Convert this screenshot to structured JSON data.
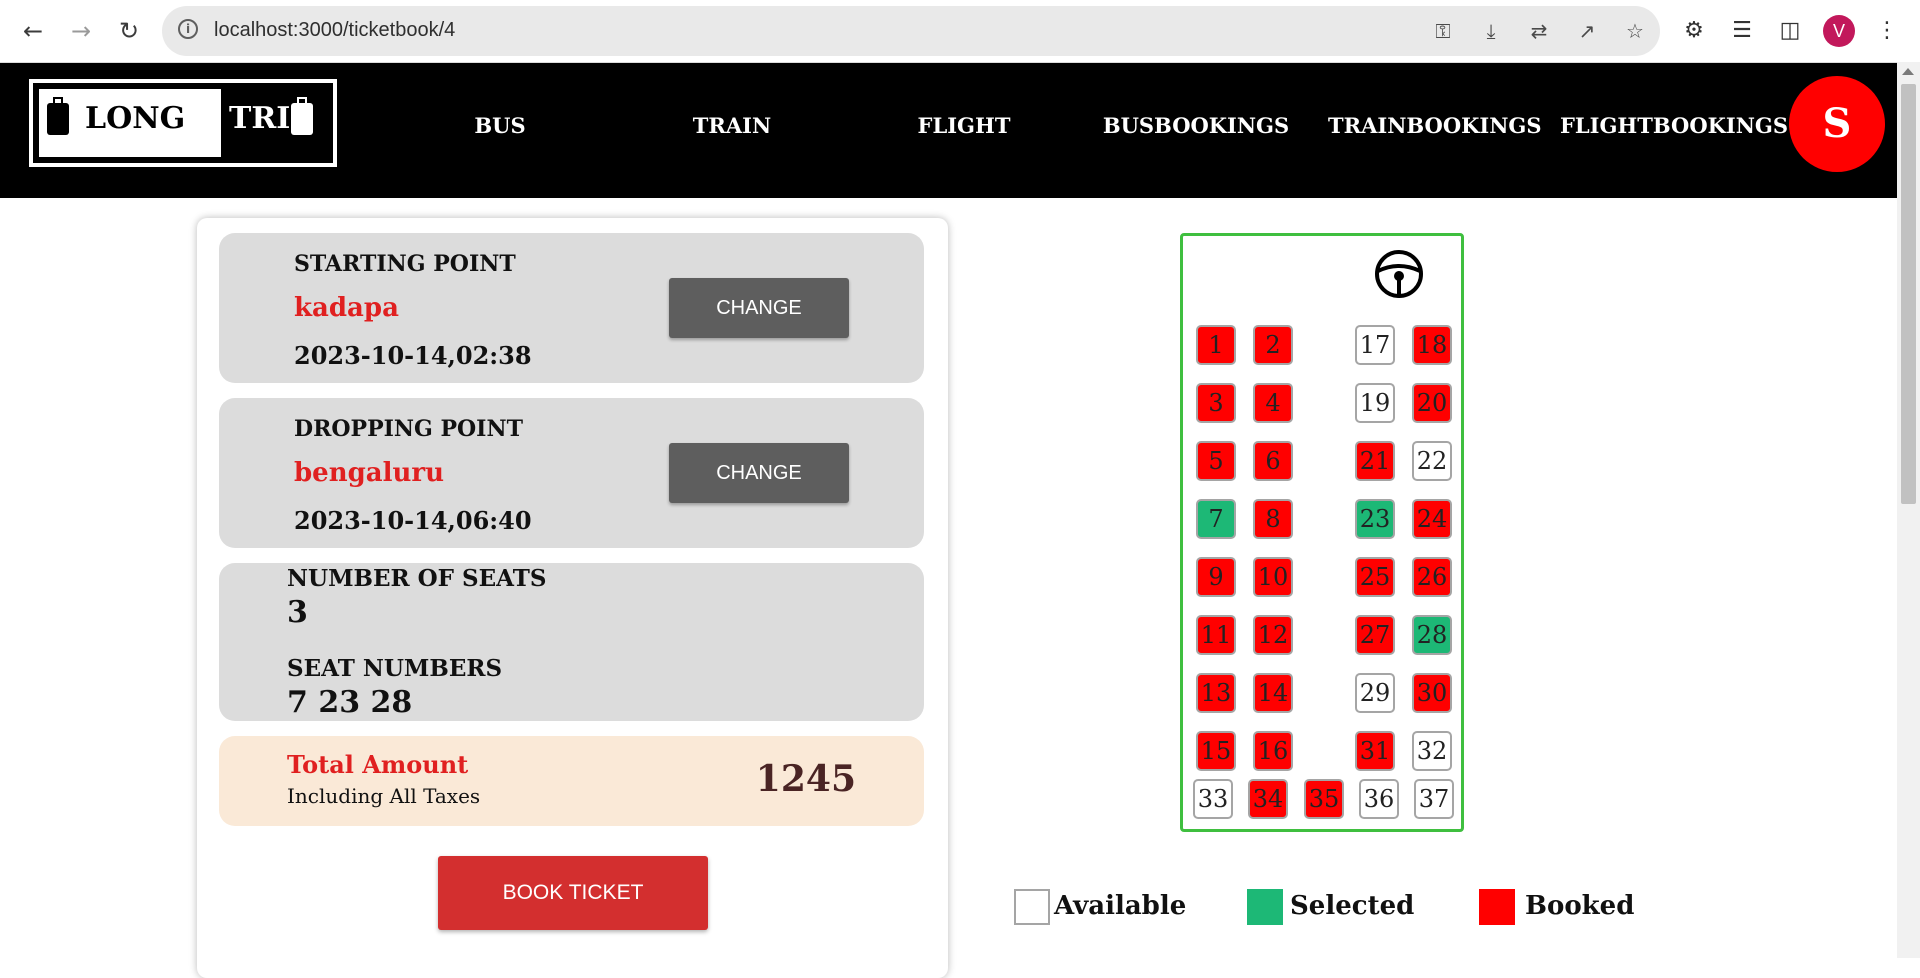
{
  "browser": {
    "url": "localhost:3000/ticketbook/4",
    "profile_initial": "V"
  },
  "navbar": {
    "logo_word1": "LONG",
    "logo_word2": "TRIP",
    "links": [
      "BUS",
      "TRAIN",
      "FLIGHT",
      "BUSBOOKINGS",
      "TRAINBOOKINGS",
      "FLIGHTBOOKINGS"
    ],
    "user_initial": "S"
  },
  "booking": {
    "starting": {
      "label": "STARTING POINT",
      "place": "kadapa",
      "datetime": "2023-10-14,02:38",
      "button": "CHANGE"
    },
    "dropping": {
      "label": "DROPPING POINT",
      "place": "bengaluru",
      "datetime": "2023-10-14,06:40",
      "button": "CHANGE"
    },
    "seats": {
      "count_label": "NUMBER OF SEATS",
      "count": "3",
      "numbers_label": "SEAT NUMBERS",
      "numbers": "7 23 28"
    },
    "total": {
      "label": "Total Amount",
      "sub": "Including All Taxes",
      "amount": "1245"
    },
    "book_button": "BOOK TICKET"
  },
  "seat_map": {
    "seats": [
      {
        "n": "1",
        "status": "booked"
      },
      {
        "n": "2",
        "status": "booked"
      },
      {
        "n": "3",
        "status": "booked"
      },
      {
        "n": "4",
        "status": "booked"
      },
      {
        "n": "5",
        "status": "booked"
      },
      {
        "n": "6",
        "status": "booked"
      },
      {
        "n": "7",
        "status": "selected"
      },
      {
        "n": "8",
        "status": "booked"
      },
      {
        "n": "9",
        "status": "booked"
      },
      {
        "n": "10",
        "status": "booked"
      },
      {
        "n": "11",
        "status": "booked"
      },
      {
        "n": "12",
        "status": "booked"
      },
      {
        "n": "13",
        "status": "booked"
      },
      {
        "n": "14",
        "status": "booked"
      },
      {
        "n": "15",
        "status": "booked"
      },
      {
        "n": "16",
        "status": "booked"
      },
      {
        "n": "17",
        "status": "available"
      },
      {
        "n": "18",
        "status": "booked"
      },
      {
        "n": "19",
        "status": "available"
      },
      {
        "n": "20",
        "status": "booked"
      },
      {
        "n": "21",
        "status": "booked"
      },
      {
        "n": "22",
        "status": "available"
      },
      {
        "n": "23",
        "status": "selected"
      },
      {
        "n": "24",
        "status": "booked"
      },
      {
        "n": "25",
        "status": "booked"
      },
      {
        "n": "26",
        "status": "booked"
      },
      {
        "n": "27",
        "status": "booked"
      },
      {
        "n": "28",
        "status": "selected"
      },
      {
        "n": "29",
        "status": "available"
      },
      {
        "n": "30",
        "status": "booked"
      },
      {
        "n": "31",
        "status": "booked"
      },
      {
        "n": "32",
        "status": "available"
      },
      {
        "n": "33",
        "status": "available"
      },
      {
        "n": "34",
        "status": "booked"
      },
      {
        "n": "35",
        "status": "booked"
      },
      {
        "n": "36",
        "status": "available"
      },
      {
        "n": "37",
        "status": "available"
      }
    ]
  },
  "legend": {
    "available": "Available",
    "selected": "Selected",
    "booked": "Booked"
  },
  "colors": {
    "booked": "#ff0000",
    "selected": "#1db876",
    "available": "#ffffff",
    "bus_border": "#3fbf3f",
    "accent_red": "#e02020"
  }
}
